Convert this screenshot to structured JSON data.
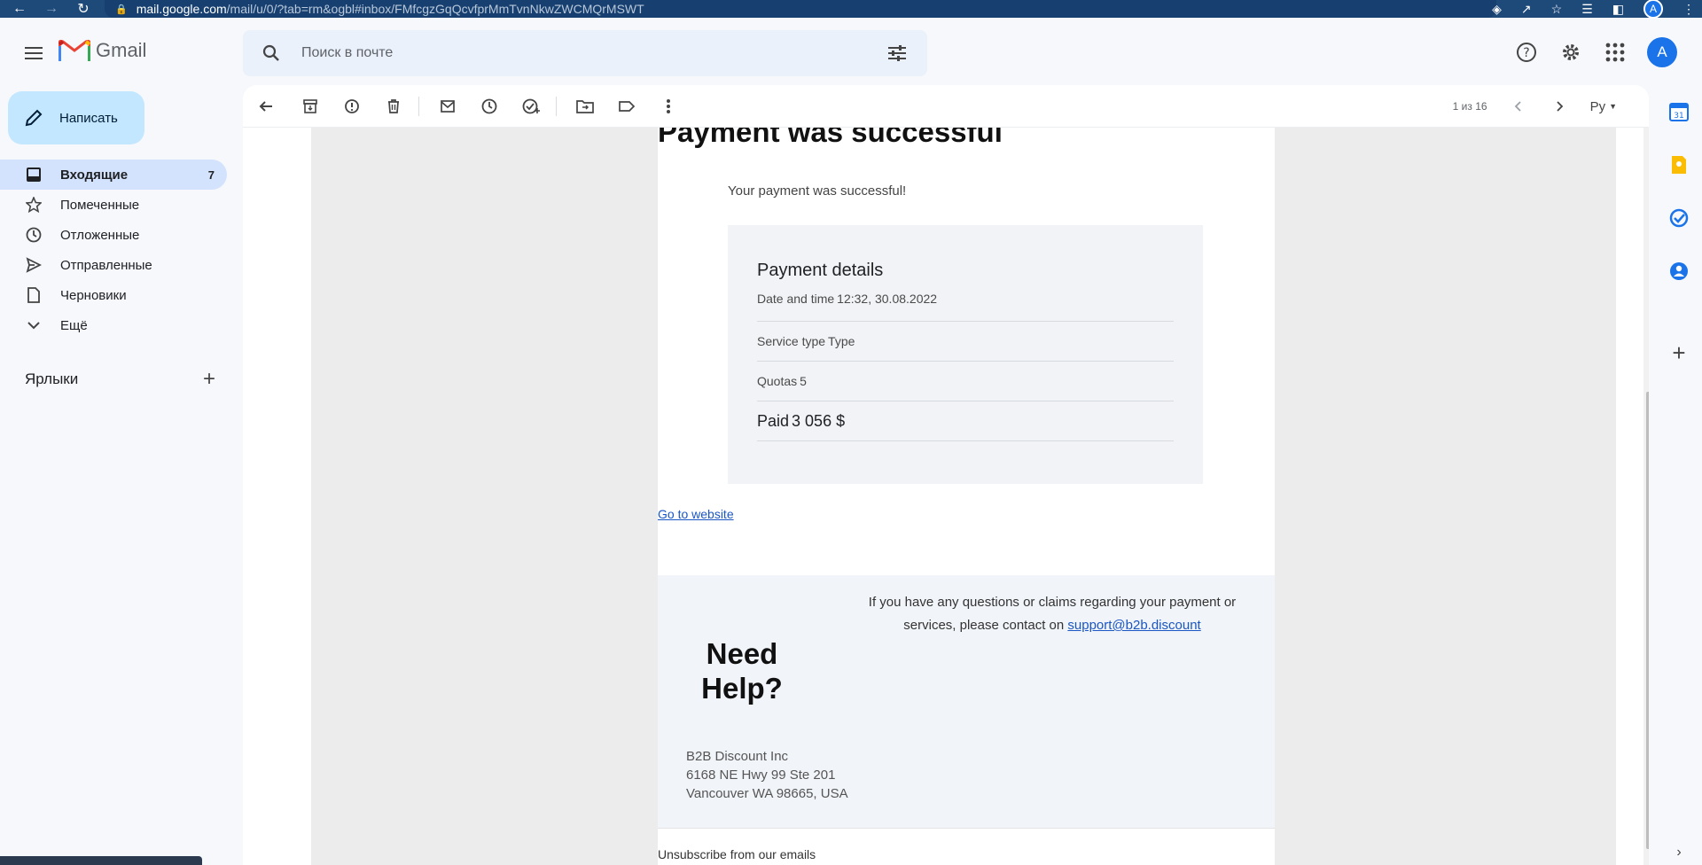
{
  "browser": {
    "url_host": "mail.google.com",
    "url_path": "/mail/u/0/?tab=rm&ogbl#inbox/FMfcgzGqQcvfprMmTvnNkwZWCMQrMSWT",
    "profile_initial": "A"
  },
  "app": {
    "name": "Gmail",
    "search_placeholder": "Поиск в почте",
    "account_initial": "A"
  },
  "sidebar": {
    "compose_label": "Написать",
    "items": [
      {
        "label": "Входящие",
        "count": "7",
        "icon": "inbox-icon"
      },
      {
        "label": "Помеченные",
        "count": "",
        "icon": "star-icon"
      },
      {
        "label": "Отложенные",
        "count": "",
        "icon": "clock-icon"
      },
      {
        "label": "Отправленные",
        "count": "",
        "icon": "send-icon"
      },
      {
        "label": "Черновики",
        "count": "",
        "icon": "draft-icon"
      },
      {
        "label": "Ещё",
        "count": "",
        "icon": "chevron-down-icon"
      }
    ],
    "labels_title": "Ярлыки"
  },
  "toolbar": {
    "pager_text": "1 из 16",
    "lang": "Ру"
  },
  "email": {
    "title": "Payment was successful",
    "lead": "Your payment was successful!",
    "details_title": "Payment details",
    "rows": [
      {
        "key": "Date and time",
        "value": "12:32, 30.08.2022"
      },
      {
        "key": "Service type",
        "value": "Type"
      },
      {
        "key": "Quotas",
        "value": "5"
      },
      {
        "key": "Paid",
        "value": "3 056 $"
      }
    ],
    "link_label": "Go to website",
    "help_text": "If you have any questions or claims regarding your payment or services, please contact on",
    "help_email": "support@b2b.discount",
    "need_help": "Need Help?",
    "address_lines": [
      "B2B Discount Inc",
      "6168 NE Hwy 99 Ste 201",
      "Vancouver WA 98665, USA"
    ],
    "unsubscribe": "Unsubscribe from our emails"
  },
  "colors": {
    "accent": "#1a73e8",
    "compose_bg": "#c2e7ff",
    "active_nav_bg": "#d3e3fd",
    "link": "#1a56c4"
  }
}
